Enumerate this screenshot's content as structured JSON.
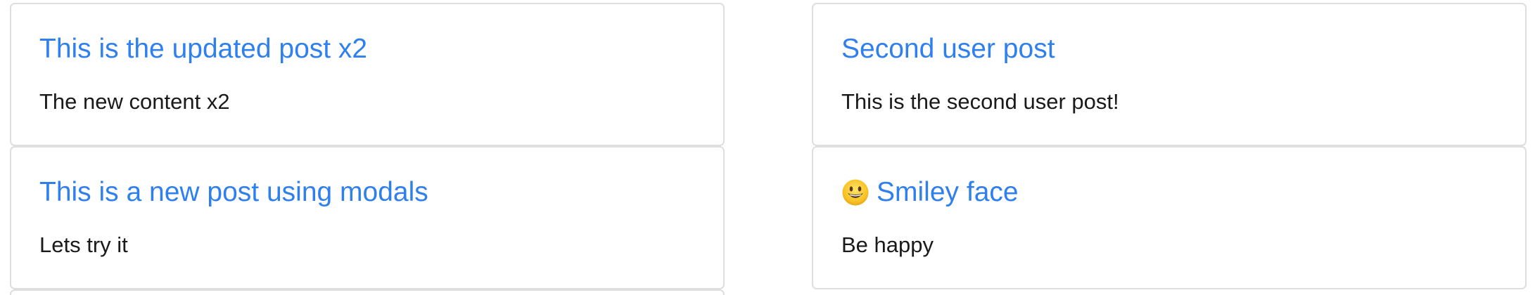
{
  "posts": {
    "left": [
      {
        "title": "This is the updated post x2",
        "content": "The new content x2"
      },
      {
        "title": "This is a new post using modals",
        "content": "Lets try it"
      }
    ],
    "right": [
      {
        "title": "Second user post",
        "content": "This is the second user post!"
      },
      {
        "title": "Smiley face",
        "content": "Be happy",
        "icon": "smiley-face-icon"
      }
    ]
  },
  "colors": {
    "title": "#2f80ed",
    "body": "#1a1a1a",
    "border": "#dedede"
  }
}
